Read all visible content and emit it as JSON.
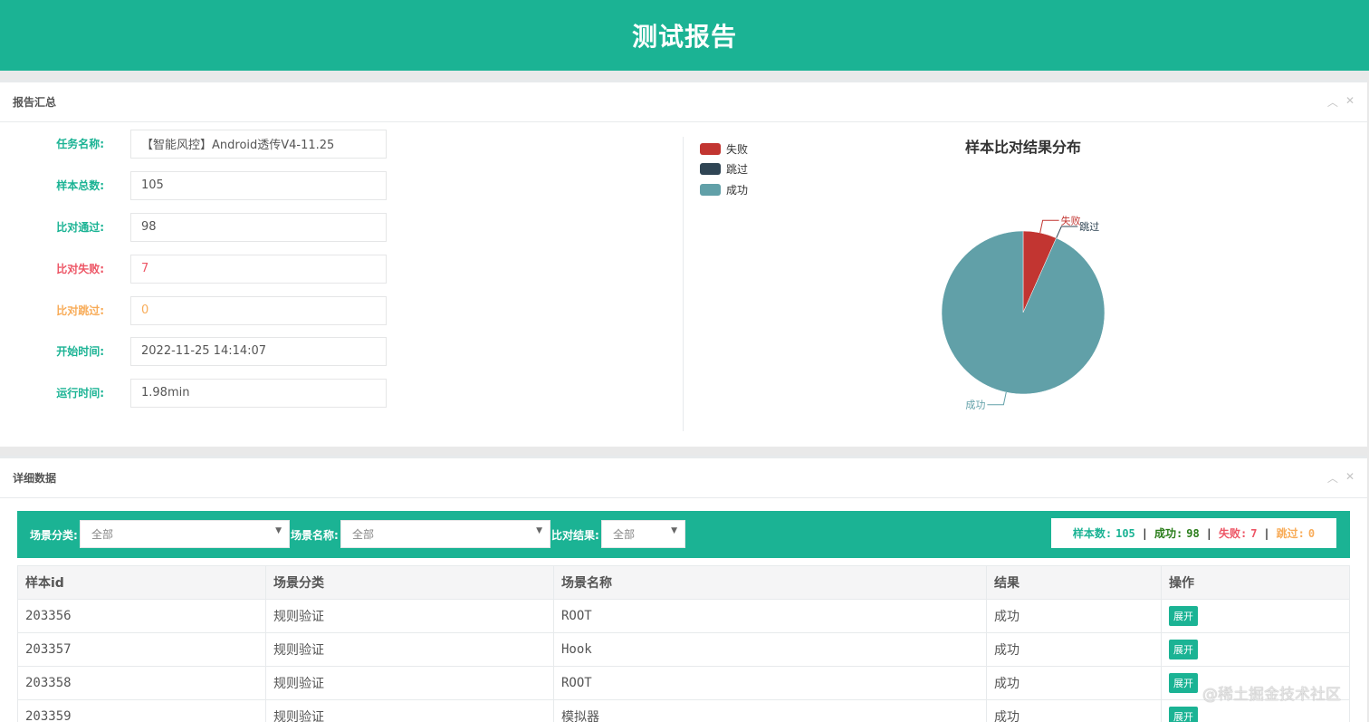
{
  "header": {
    "title": "测试报告"
  },
  "summary": {
    "title": "报告汇总",
    "fields": [
      {
        "label": "任务名称:",
        "value": "【智能风控】Android透传V4-11.25",
        "tone": "green"
      },
      {
        "label": "样本总数:",
        "value": "105",
        "tone": "green"
      },
      {
        "label": "比对通过:",
        "value": "98",
        "tone": "green"
      },
      {
        "label": "比对失败:",
        "value": "7",
        "tone": "red"
      },
      {
        "label": "比对跳过:",
        "value": "0",
        "tone": "orange"
      },
      {
        "label": "开始时间:",
        "value": "2022-11-25 14:14:07",
        "tone": "green"
      },
      {
        "label": "运行时间:",
        "value": "1.98min",
        "tone": "green"
      }
    ]
  },
  "chart_data": {
    "type": "pie",
    "title": "样本比对结果分布",
    "legend_position": "top-left",
    "slices": [
      {
        "label": "失败",
        "value": 7,
        "color": "#c23531"
      },
      {
        "label": "跳过",
        "value": 0,
        "color": "#2f4554"
      },
      {
        "label": "成功",
        "value": 98,
        "color": "#61a0a8"
      }
    ]
  },
  "detail": {
    "title": "详细数据",
    "filters": {
      "category_label": "场景分类:",
      "category_value": "全部",
      "name_label": "场景名称:",
      "name_value": "全部",
      "result_label": "比对结果:",
      "result_value": "全部"
    },
    "stats": {
      "total_label": "样本数:",
      "total": "105",
      "success_label": "成功:",
      "success": "98",
      "fail_label": "失败:",
      "fail": "7",
      "skip_label": "跳过:",
      "skip": "0",
      "sep": "|"
    },
    "table": {
      "columns": [
        "样本id",
        "场景分类",
        "场景名称",
        "结果",
        "操作"
      ],
      "rows": [
        {
          "id": "203356",
          "category": "规则验证",
          "name": "ROOT",
          "result": "成功",
          "action": "展开"
        },
        {
          "id": "203357",
          "category": "规则验证",
          "name": "Hook",
          "result": "成功",
          "action": "展开"
        },
        {
          "id": "203358",
          "category": "规则验证",
          "name": "ROOT",
          "result": "成功",
          "action": "展开"
        },
        {
          "id": "203359",
          "category": "规则验证",
          "name": "模拟器",
          "result": "成功",
          "action": "展开"
        }
      ]
    }
  },
  "watermark": "@稀土掘金技术社区",
  "colors": {
    "primary": "#1bb394",
    "danger": "#ed5565",
    "warning": "#f8ac59"
  },
  "icons": {
    "collapse": "chevron-up-icon",
    "close": "close-icon",
    "caret": "caret-down-icon"
  }
}
